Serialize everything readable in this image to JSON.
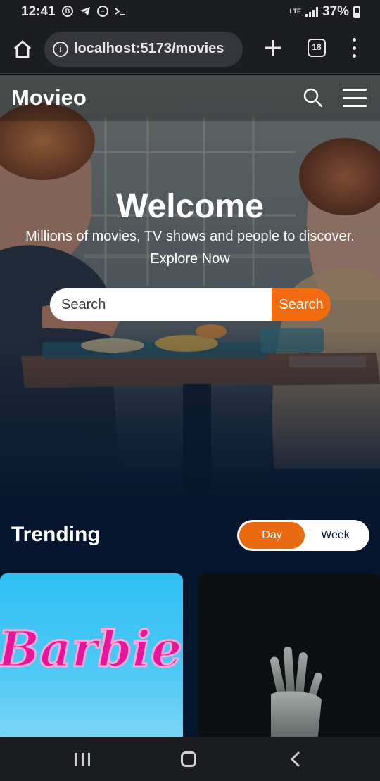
{
  "status_bar": {
    "time": "12:41",
    "lte": "LTE",
    "battery": "37%"
  },
  "browser": {
    "url": "localhost:5173/movies",
    "tab_count": "18"
  },
  "header": {
    "logo": "Movieo"
  },
  "hero": {
    "title": "Welcome",
    "subtitle": "Millions of movies, TV shows and people to discover.",
    "explore": "Explore Now",
    "search_placeholder": "Search",
    "search_button": "Search"
  },
  "trending": {
    "title": "Trending",
    "tabs": [
      {
        "label": "Day",
        "active": true
      },
      {
        "label": "Week",
        "active": false
      }
    ],
    "cards": [
      {
        "poster_text": "Barbie"
      }
    ]
  },
  "colors": {
    "accent": "#f26b0f",
    "background": "#04152d",
    "barbie_pink": "#e8159a"
  }
}
